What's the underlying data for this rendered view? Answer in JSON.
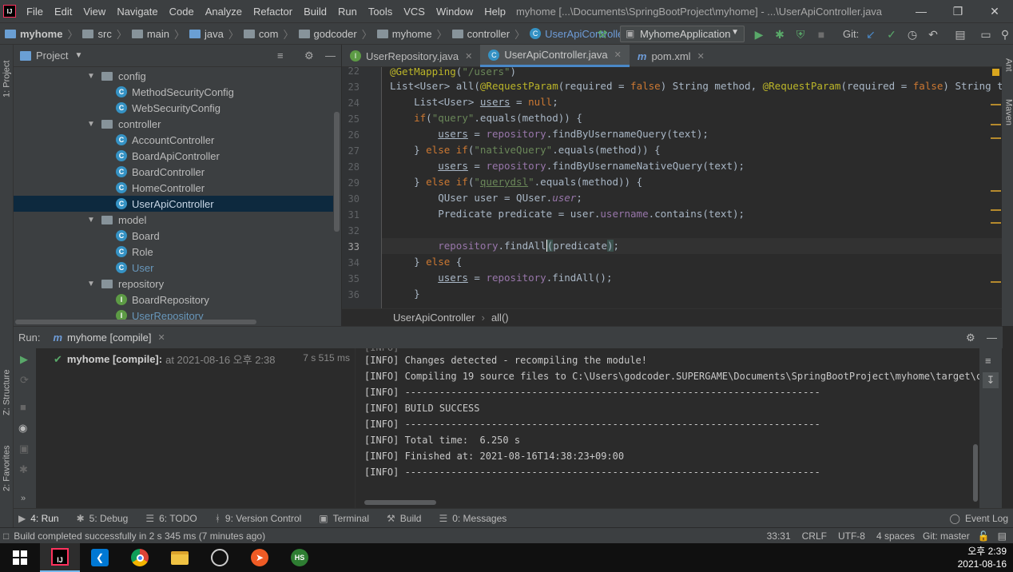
{
  "window": {
    "title": "myhome [...\\Documents\\SpringBootProject\\myhome] - ...\\UserApiController.java",
    "menu": [
      "File",
      "Edit",
      "View",
      "Navigate",
      "Code",
      "Analyze",
      "Refactor",
      "Build",
      "Run",
      "Tools",
      "VCS",
      "Window",
      "Help"
    ]
  },
  "breadcrumb": {
    "items": [
      "myhome",
      "src",
      "main",
      "java",
      "com",
      "godcoder",
      "myhome",
      "controller"
    ],
    "current_class": "UserApiController"
  },
  "toolbar": {
    "run_config": "MyhomeApplication",
    "git_label": "Git:"
  },
  "left_strip": {
    "project": "1: Project",
    "structure": "Z: Structure",
    "favorites": "2: Favorites"
  },
  "right_strip": {
    "ant": "Ant",
    "maven": "Maven"
  },
  "project": {
    "title": "Project",
    "tree": [
      {
        "label": "config",
        "type": "folder",
        "depth": 0
      },
      {
        "label": "MethodSecurityConfig",
        "type": "class",
        "depth": 1
      },
      {
        "label": "WebSecurityConfig",
        "type": "class",
        "depth": 1
      },
      {
        "label": "controller",
        "type": "folder",
        "depth": 0
      },
      {
        "label": "AccountController",
        "type": "class",
        "depth": 1
      },
      {
        "label": "BoardApiController",
        "type": "class",
        "depth": 1
      },
      {
        "label": "BoardController",
        "type": "class",
        "depth": 1
      },
      {
        "label": "HomeController",
        "type": "class",
        "depth": 1
      },
      {
        "label": "UserApiController",
        "type": "class",
        "depth": 1,
        "selected": true
      },
      {
        "label": "model",
        "type": "folder",
        "depth": 0
      },
      {
        "label": "Board",
        "type": "class",
        "depth": 1
      },
      {
        "label": "Role",
        "type": "class",
        "depth": 1
      },
      {
        "label": "User",
        "type": "class",
        "depth": 1,
        "highlight": true
      },
      {
        "label": "repository",
        "type": "folder",
        "depth": 0
      },
      {
        "label": "BoardRepository",
        "type": "interface",
        "depth": 1
      },
      {
        "label": "UserRepository",
        "type": "interface",
        "depth": 1,
        "highlight": true
      }
    ]
  },
  "editor": {
    "tabs": [
      {
        "label": "UserRepository.java",
        "icon": "interface-icon"
      },
      {
        "label": "UserApiController.java",
        "icon": "class-icon",
        "active": true
      },
      {
        "label": "pom.xml",
        "icon": "maven-icon"
      }
    ],
    "line_numbers": [
      "22",
      "23",
      "24",
      "25",
      "26",
      "27",
      "28",
      "29",
      "30",
      "31",
      "32",
      "33",
      "34",
      "35",
      "36"
    ],
    "breadcrumb_class": "UserApiController",
    "breadcrumb_method": "all()"
  },
  "run": {
    "label": "Run:",
    "tab": "myhome [compile]",
    "tree_item": "myhome [compile]:",
    "tree_time": "at 2021-08-16 오후 2:38",
    "tree_duration": "7 s 515 ms",
    "console": [
      "[INFO] Changes detected - recompiling the module!",
      "[INFO] Compiling 19 source files to C:\\Users\\godcoder.SUPERGAME\\Documents\\SpringBootProject\\myhome\\target\\classes",
      "[INFO] ------------------------------------------------------------------------",
      "[INFO] BUILD SUCCESS",
      "[INFO] ------------------------------------------------------------------------",
      "[INFO] Total time:  6.250 s",
      "[INFO] Finished at: 2021-08-16T14:38:23+09:00",
      "[INFO] ------------------------------------------------------------------------"
    ]
  },
  "tool_tabs": [
    {
      "label": "4: Run",
      "icon": "▶",
      "active": true
    },
    {
      "label": "5: Debug",
      "icon": "✱"
    },
    {
      "label": "6: TODO",
      "icon": "☰"
    },
    {
      "label": "9: Version Control",
      "icon": "ᚼ"
    },
    {
      "label": "Terminal",
      "icon": "▣"
    },
    {
      "label": "Build",
      "icon": "⚒"
    },
    {
      "label": "0: Messages",
      "icon": "☰"
    }
  ],
  "event_log": "Event Log",
  "status": {
    "message": "Build completed successfully in 2 s 345 ms (7 minutes ago)",
    "position": "33:31",
    "line_sep": "CRLF",
    "encoding": "UTF-8",
    "indent": "4 spaces",
    "git": "Git: master"
  },
  "taskbar": {
    "time": "오후 2:39",
    "date": "2021-08-16"
  }
}
